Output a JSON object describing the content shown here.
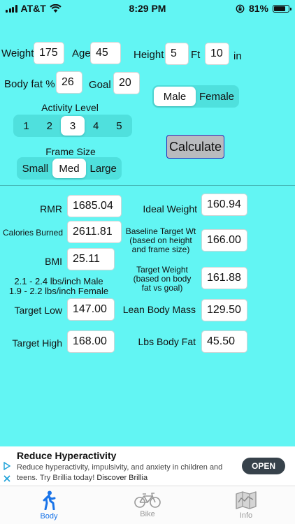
{
  "status": {
    "carrier": "AT&T",
    "time": "8:29 PM",
    "battery": "81%",
    "battery_level": 0.81
  },
  "inputs": {
    "weight_label": "Weight",
    "weight": "175",
    "age_label": "Age",
    "age": "45",
    "height_label": "Height",
    "height_ft": "5",
    "ft_label": "Ft",
    "height_in": "10",
    "in_label": "in",
    "bodyfat_label": "Body fat %",
    "bodyfat": "26",
    "goal_label": "Goal",
    "goal": "20"
  },
  "sex": {
    "options": [
      "Male",
      "Female"
    ],
    "selected": "Male"
  },
  "activity": {
    "label": "Activity Level",
    "options": [
      "1",
      "2",
      "3",
      "4",
      "5"
    ],
    "selected": "3"
  },
  "frame": {
    "label": "Frame Size",
    "options": [
      "Small",
      "Med",
      "Large"
    ],
    "selected": "Med"
  },
  "calculate_label": "Calculate",
  "results": {
    "rmr_label": "RMR",
    "rmr": "1685.04",
    "calories_label": "Calories Burned",
    "calories": "2611.81",
    "bmi_label": "BMI",
    "bmi": "25.11",
    "note_male": "2.1 - 2.4 lbs/inch Male",
    "note_female": "1.9 - 2.2 lbs/inch Female",
    "target_low_label": "Target Low",
    "target_low": "147.00",
    "target_high_label": "Target High",
    "target_high": "168.00",
    "ideal_weight_label": "Ideal Weight",
    "ideal_weight": "160.94",
    "baseline_label_1": "Baseline Target Wt",
    "baseline_label_2": "(based on height",
    "baseline_label_3": "and frame size)",
    "baseline": "166.00",
    "target_weight_label_1": "Target Weight",
    "target_weight_label_2": "(based on body",
    "target_weight_label_3": "fat vs goal)",
    "target_weight": "161.88",
    "lean_mass_label": "Lean Body Mass",
    "lean_mass": "129.50",
    "lbs_fat_label": "Lbs Body Fat",
    "lbs_fat": "45.50"
  },
  "ad": {
    "title": "Reduce Hyperactivity",
    "text_1": "Reduce hyperactivity, impulsivity, and anxiety in children and",
    "text_2": "teens. Try Brillia today!",
    "link": "Discover Brillia",
    "button": "OPEN"
  },
  "tabs": [
    {
      "label": "Body",
      "icon": "walking-person-icon"
    },
    {
      "label": "Bike",
      "icon": "bicycle-icon"
    },
    {
      "label": "Info",
      "icon": "map-icon"
    }
  ],
  "colors": {
    "background": "#62f5f3",
    "segment": "#4fe0dd",
    "active_tab": "#1a74e8",
    "button": "#b9bbbe"
  }
}
